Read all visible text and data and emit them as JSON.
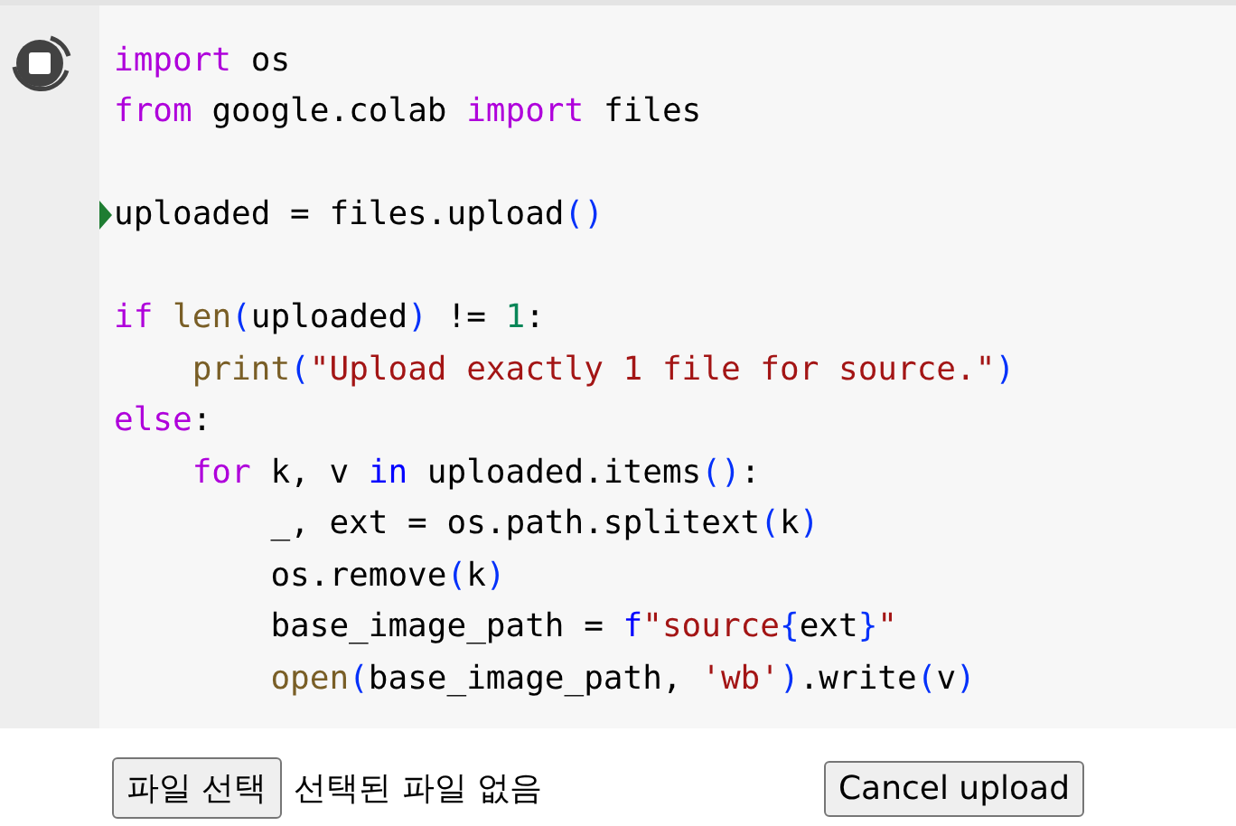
{
  "cell": {
    "running": true,
    "lines": [
      {
        "kind": "code",
        "current": false,
        "tokens": [
          {
            "t": "import",
            "kind": "keyword"
          },
          {
            "t": " os",
            "kind": "plain"
          }
        ]
      },
      {
        "kind": "code",
        "current": false,
        "tokens": [
          {
            "t": "from",
            "kind": "keyword"
          },
          {
            "t": " google.colab ",
            "kind": "plain"
          },
          {
            "t": "import",
            "kind": "keyword"
          },
          {
            "t": " files",
            "kind": "plain"
          }
        ]
      },
      {
        "kind": "blank",
        "current": false
      },
      {
        "kind": "code",
        "current": true,
        "tokens": [
          {
            "t": "uploaded = files.upload",
            "kind": "plain"
          },
          {
            "t": "()",
            "kind": "bracket"
          }
        ]
      },
      {
        "kind": "blank",
        "current": false
      },
      {
        "kind": "code",
        "current": false,
        "tokens": [
          {
            "t": "if",
            "kind": "keyword"
          },
          {
            "t": " len",
            "kind": "builtin"
          },
          {
            "t": "(",
            "kind": "bracket"
          },
          {
            "t": "uploaded",
            "kind": "plain"
          },
          {
            "t": ")",
            "kind": "bracket"
          },
          {
            "t": " != ",
            "kind": "plain"
          },
          {
            "t": "1",
            "kind": "number"
          },
          {
            "t": ":",
            "kind": "plain"
          }
        ]
      },
      {
        "kind": "code",
        "current": false,
        "tokens": [
          {
            "t": "    print",
            "kind": "builtin"
          },
          {
            "t": "(",
            "kind": "bracket"
          },
          {
            "t": "\"Upload exactly 1 file for source.\"",
            "kind": "string"
          },
          {
            "t": ")",
            "kind": "bracket"
          }
        ]
      },
      {
        "kind": "code",
        "current": false,
        "tokens": [
          {
            "t": "else",
            "kind": "keyword"
          },
          {
            "t": ":",
            "kind": "plain"
          }
        ]
      },
      {
        "kind": "code",
        "current": false,
        "tokens": [
          {
            "t": "    for",
            "kind": "keyword"
          },
          {
            "t": " k, v ",
            "kind": "plain"
          },
          {
            "t": "in",
            "kind": "operator"
          },
          {
            "t": " uploaded.items",
            "kind": "plain"
          },
          {
            "t": "()",
            "kind": "bracket"
          },
          {
            "t": ":",
            "kind": "plain"
          }
        ]
      },
      {
        "kind": "code",
        "current": false,
        "tokens": [
          {
            "t": "        _, ext = os.path.splitext",
            "kind": "plain"
          },
          {
            "t": "(",
            "kind": "bracket"
          },
          {
            "t": "k",
            "kind": "plain"
          },
          {
            "t": ")",
            "kind": "bracket"
          }
        ]
      },
      {
        "kind": "code",
        "current": false,
        "tokens": [
          {
            "t": "        os.remove",
            "kind": "plain"
          },
          {
            "t": "(",
            "kind": "bracket"
          },
          {
            "t": "k",
            "kind": "plain"
          },
          {
            "t": ")",
            "kind": "bracket"
          }
        ]
      },
      {
        "kind": "code",
        "current": false,
        "tokens": [
          {
            "t": "        base_image_path = ",
            "kind": "plain"
          },
          {
            "t": "f",
            "kind": "operator"
          },
          {
            "t": "\"source",
            "kind": "string"
          },
          {
            "t": "{",
            "kind": "bracket"
          },
          {
            "t": "ext",
            "kind": "plain"
          },
          {
            "t": "}",
            "kind": "bracket"
          },
          {
            "t": "\"",
            "kind": "string"
          }
        ]
      },
      {
        "kind": "code",
        "current": false,
        "tokens": [
          {
            "t": "        open",
            "kind": "builtin"
          },
          {
            "t": "(",
            "kind": "bracket"
          },
          {
            "t": "base_image_path, ",
            "kind": "plain"
          },
          {
            "t": "'wb'",
            "kind": "string"
          },
          {
            "t": ")",
            "kind": "bracket"
          },
          {
            "t": ".write",
            "kind": "plain"
          },
          {
            "t": "(",
            "kind": "bracket"
          },
          {
            "t": "v",
            "kind": "plain"
          },
          {
            "t": ")",
            "kind": "bracket"
          }
        ]
      }
    ]
  },
  "upload": {
    "choose_button": "파일 선택",
    "file_status": "선택된 파일 없음",
    "cancel_button": "Cancel upload"
  }
}
